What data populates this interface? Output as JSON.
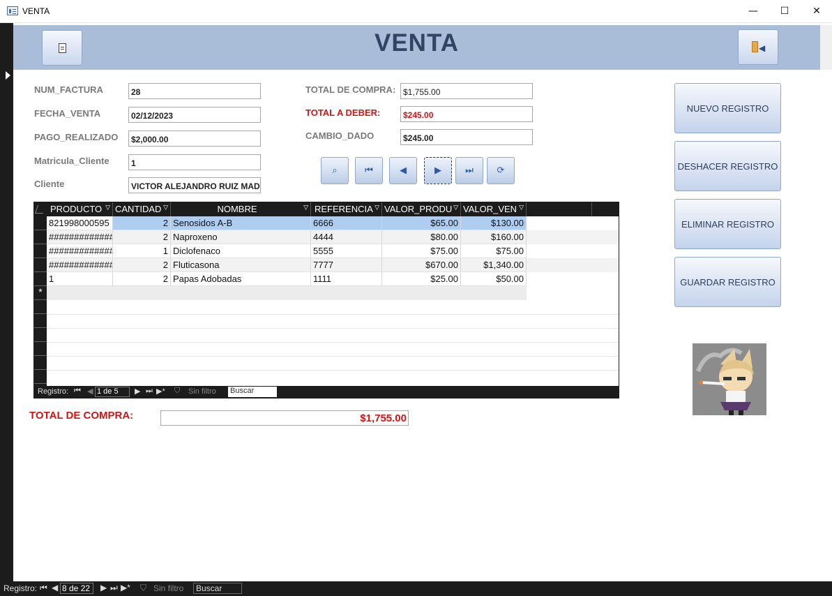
{
  "window": {
    "title": "VENTA",
    "minimize": "—",
    "maximize": "☐",
    "close": "✕"
  },
  "header": {
    "title": "VENTA"
  },
  "fields": {
    "num_factura": {
      "label": "NUM_FACTURA",
      "value": "28"
    },
    "fecha_venta": {
      "label": "FECHA_VENTA",
      "value": "02/12/2023"
    },
    "pago_realizado": {
      "label": "PAGO_REALIZADO",
      "value": "$2,000.00"
    },
    "matricula_cliente": {
      "label": "Matricula_Cliente",
      "value": "1"
    },
    "cliente": {
      "label": "Cliente",
      "value": "VICTOR ALEJANDRO RUIZ MAD"
    },
    "total_compra": {
      "label": "TOTAL DE COMPRA:",
      "value": "$1,755.00"
    },
    "total_deber": {
      "label": "TOTAL A DEBER:",
      "value": "$245.00"
    },
    "cambio_dado": {
      "label": "CAMBIO_DADO",
      "value": "$245.00"
    }
  },
  "actions": {
    "nuevo": "NUEVO REGISTRO",
    "deshacer": "DESHACER REGISTRO",
    "eliminar": "ELIMINAR REGISTRO",
    "guardar": "GUARDAR REGISTRO"
  },
  "subform": {
    "columns": [
      "PRODUCTO",
      "CANTIDAD",
      "NOMBRE",
      "REFERENCIA",
      "VALOR_PRODU",
      "VALOR_VEN"
    ],
    "rows": [
      [
        "821998000595",
        "2",
        "Senosidos A-B",
        "6666",
        "$65.00",
        "$130.00"
      ],
      [
        "#############",
        "2",
        "Naproxeno",
        "4444",
        "$80.00",
        "$160.00"
      ],
      [
        "#############",
        "1",
        "Diclofenaco",
        "5555",
        "$75.00",
        "$75.00"
      ],
      [
        "#############",
        "2",
        "Fluticasona",
        "7777",
        "$670.00",
        "$1,340.00"
      ],
      [
        "1",
        "2",
        "Papas Adobadas",
        "1111",
        "$25.00",
        "$50.00"
      ]
    ],
    "new_row_marker": "*",
    "nav": {
      "label": "Registro:",
      "position": "1 de 5",
      "filter": "Sin filtro",
      "search": "Buscar"
    }
  },
  "main_nav": {
    "label": "Registro:",
    "position": "8 de 22",
    "filter": "Sin filtro",
    "search": "Buscar"
  },
  "total": {
    "label": "TOTAL DE COMPRA:",
    "value": "$1,755.00"
  },
  "colors": {
    "header_band": "#a9bcd8",
    "title": "#2f4563",
    "accent_red": "#d21414",
    "selected_row": "#aecdf0"
  }
}
